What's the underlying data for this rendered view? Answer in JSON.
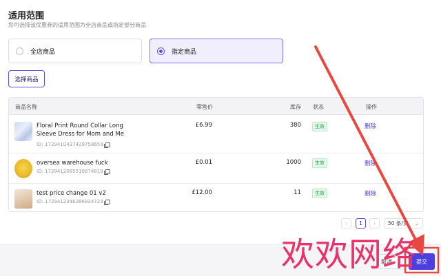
{
  "section": {
    "title": "适用范围",
    "subtitle": "您可选择该优惠券的适用范围为全店商品或指定部分商品"
  },
  "scope_options": [
    {
      "label": "全店商品",
      "selected": false
    },
    {
      "label": "指定商品",
      "selected": true
    }
  ],
  "select_button_label": "选择商品",
  "table": {
    "headers": {
      "name": "商品名称",
      "price": "零售价",
      "stock": "库存",
      "status": "状态",
      "action": "操作"
    },
    "rows": [
      {
        "name": "Floral Print Round Collar Long Sleeve Dress for Mom and Me",
        "id": "ID: 1729410437429758659",
        "price": "£6.99",
        "stock": "380",
        "status": "生效",
        "action": "删除"
      },
      {
        "name": "oversea warehouse fuck",
        "id": "ID: 1729412095510874819",
        "price": "£0.01",
        "stock": "1000",
        "status": "生效",
        "action": "删除"
      },
      {
        "name": "test price change 01 v2",
        "id": "ID: 1729412346286934723",
        "price": "£12.00",
        "stock": "11",
        "status": "生效",
        "action": "删除"
      }
    ]
  },
  "pagination": {
    "prev_icon": "chevron-left-icon",
    "current_page": "1",
    "next_icon": "chevron-right-icon",
    "page_size": "50 条/页"
  },
  "footer": {
    "cancel_label": "取消",
    "submit_label": "提交"
  },
  "watermark_text": "欢欢网络",
  "colors": {
    "accent": "#5b4ee8",
    "status_green": "#22a34a",
    "annotation_red": "#e8326a"
  }
}
